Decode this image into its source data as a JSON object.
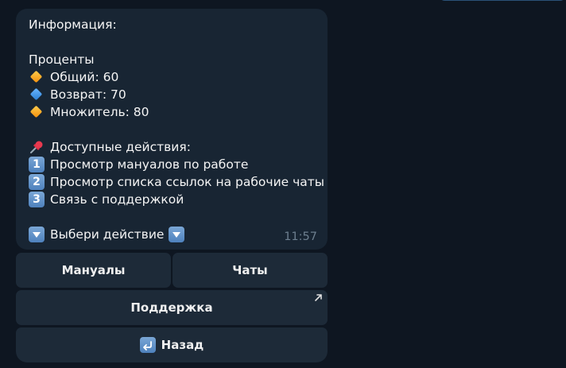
{
  "message": {
    "title": "Информация:",
    "percent_header": "Проценты",
    "percents": [
      {
        "icon": "orange-diamond-icon",
        "text": "Общий: 60"
      },
      {
        "icon": "blue-diamond-icon",
        "text": "Возврат: 70"
      },
      {
        "icon": "orange-diamond-icon",
        "text": "Множитель: 80"
      }
    ],
    "actions_header": "Доступные действия:",
    "actions": [
      {
        "num": "1",
        "text": "Просмотр мануалов по работе"
      },
      {
        "num": "2",
        "text": "Просмотр списка ссылок на рабочие чаты"
      },
      {
        "num": "3",
        "text": "Связь с поддержкой"
      }
    ],
    "prompt": "Выбери действие",
    "time": "11:57"
  },
  "keyboard": {
    "manuals": "Мануалы",
    "chats": "Чаты",
    "support": "Поддержка",
    "back": "Назад"
  },
  "colors": {
    "background": "#0e1621",
    "bubble": "#182533",
    "button": "#1d2a38",
    "time": "#6d7f8f"
  }
}
